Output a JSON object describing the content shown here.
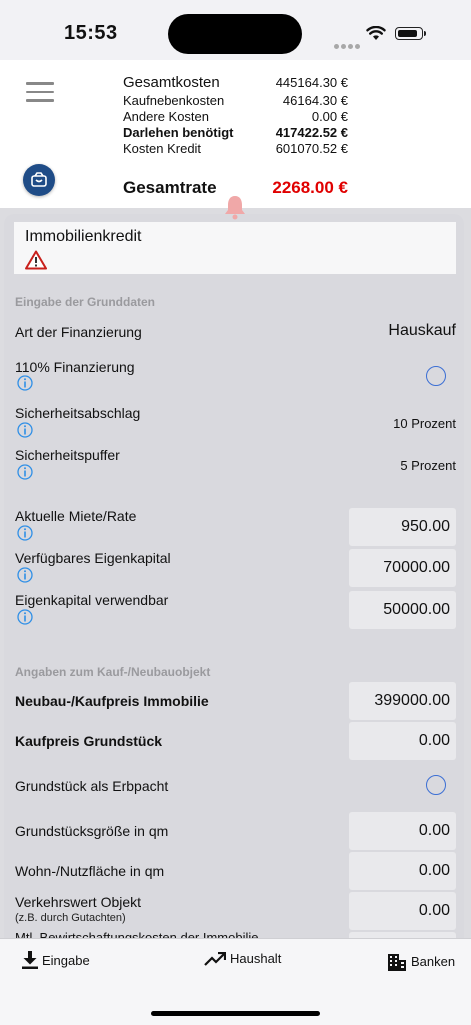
{
  "status_bar": {
    "time": "15:53",
    "battery_level": 0.9
  },
  "header": {
    "rows": [
      {
        "label": "Gesamtkosten",
        "value": "445164.30 €"
      },
      {
        "label": "Kaufnebenkosten",
        "value": "46164.30 €"
      },
      {
        "label": "Andere Kosten",
        "value": "0.00 €"
      },
      {
        "label": "Darlehen benötigt",
        "value": "417422.52 €"
      },
      {
        "label": "Kosten Kredit",
        "value": "601070.52 €"
      }
    ],
    "total": {
      "label": "Gesamtrate",
      "value": "2268.00 €"
    },
    "menu_icon": "hamburger-menu-icon",
    "action_icon": "piggy-bank-icon",
    "alert_icon": "bell-icon",
    "colors": {
      "total_value": "#e00000",
      "fab": "#1f4c87"
    }
  },
  "main": {
    "title": "Immobilienkredit",
    "warning_icon": "warning-triangle-icon",
    "section1": "Eingabe der Grunddaten",
    "art_label": "Art der Finanzierung",
    "art_value": "Hauskauf",
    "f110_label": "110% Finanzierung",
    "sicherheitsabschlag_label": "Sicherheitsabschlag",
    "sicherheitsabschlag_value": "10 Prozent",
    "sicherheitspuffer_label": "Sicherheitspuffer",
    "sicherheitspuffer_value": "5 Prozent",
    "miete_label": "Aktuelle Miete/Rate",
    "miete_value": "950.00",
    "eigenkapital_label": "Verfügbares Eigenkapital",
    "eigenkapital_value": "70000.00",
    "ek_verwendbar_label": "Eigenkapital verwendbar",
    "ek_verwendbar_value": "50000.00",
    "section2": "Angaben zum Kauf-/Neubauobjekt",
    "kaufpreis_label": "Neubau-/Kaufpreis Immobilie",
    "kaufpreis_value": "399000.00",
    "grundstueck_label": "Kaufpreis Grundstück",
    "grundstueck_value": "0.00",
    "erbpacht_label": "Grundstück als Erbpacht",
    "groesse_label": "Grundstücksgröße in qm",
    "groesse_value": "0.00",
    "wohnflaeche_label": "Wohn-/Nutzfläche in qm",
    "wohnflaeche_value": "0.00",
    "verkehrswert_label": "Verkehrswert Objekt",
    "verkehrswert_sub": "(z.B. durch Gutachten)",
    "verkehrswert_value": "0.00",
    "bewirtschaftung_label": "Mtl. Bewirtschaftungskosten der Immobilie"
  },
  "tabbar": {
    "tabs": [
      {
        "label": "Eingabe",
        "icon": "download-icon"
      },
      {
        "label": "Haushalt",
        "icon": "trend-up-icon"
      },
      {
        "label": "Banken",
        "icon": "building-icon"
      }
    ]
  }
}
